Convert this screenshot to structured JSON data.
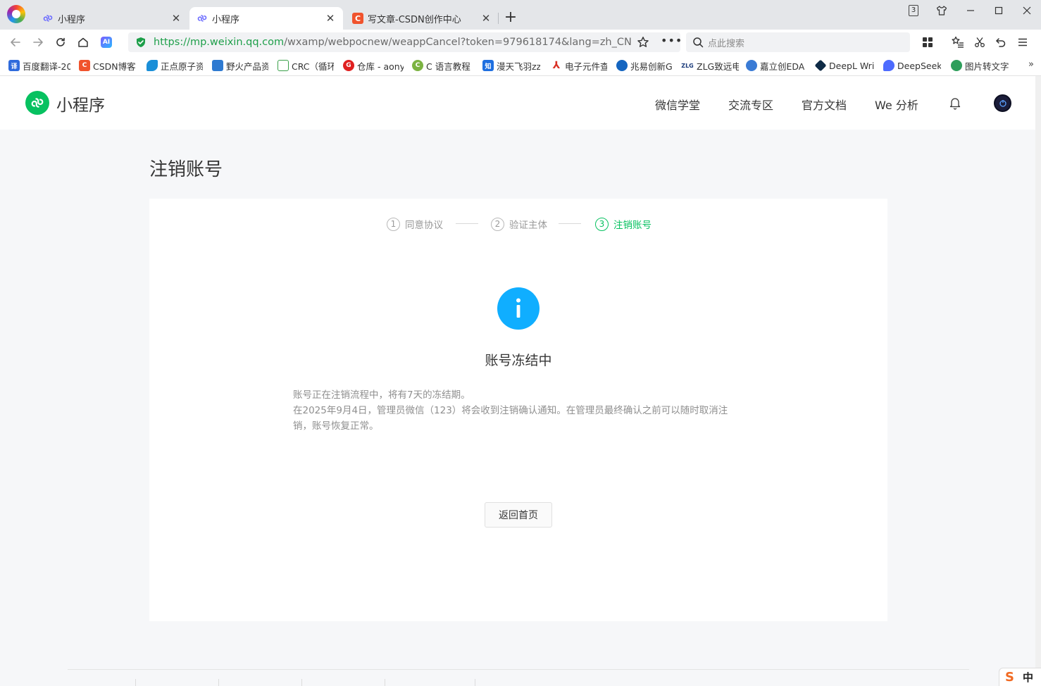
{
  "browser": {
    "tabs": [
      {
        "title": "小程序",
        "active": false
      },
      {
        "title": "小程序",
        "active": true
      },
      {
        "title": "写文章-CSDN创作中心",
        "active": false
      }
    ],
    "new_tab_label": "+",
    "tab_count": "3",
    "url": {
      "scheme_host": "https://mp.weixin.qq.com",
      "path": "/wxamp/webpocnew/weappCancel?token=979618174&lang=zh_CN"
    },
    "search_placeholder": "点此搜索",
    "ai_label": "AI",
    "bookmarks": [
      {
        "label": "百度翻译-20",
        "icon_color": "#2f6bdc",
        "glyph": "译"
      },
      {
        "label": "CSDN博客",
        "icon_color": "#f0532d",
        "glyph": "C"
      },
      {
        "label": "正点原子资",
        "icon_color": "#1a8fd8",
        "glyph": ""
      },
      {
        "label": "野火产品资",
        "icon_color": "#2e7ad1",
        "glyph": ""
      },
      {
        "label": "CRC（循环",
        "icon_color": "#3aa04a",
        "glyph": ""
      },
      {
        "label": "仓库 - aony",
        "icon_color": "#e02020",
        "glyph": "G"
      },
      {
        "label": "C 语言教程",
        "icon_color": "#7cb342",
        "glyph": "C"
      },
      {
        "label": "漫天飞羽zz",
        "icon_color": "#1e6fe0",
        "glyph": "知"
      },
      {
        "label": "电子元件查",
        "icon_color": "#d93025",
        "glyph": ""
      },
      {
        "label": "兆易创新GI",
        "icon_color": "#1565c0",
        "glyph": ""
      },
      {
        "label": "ZLG致远电",
        "icon_color": "#1a3a7a",
        "glyph": "ZLG"
      },
      {
        "label": "嘉立创EDA",
        "icon_color": "#3a7bd5",
        "glyph": ""
      },
      {
        "label": "DeepL Writ",
        "icon_color": "#0f2b46",
        "glyph": ""
      },
      {
        "label": "DeepSeek",
        "icon_color": "#4d6bfe",
        "glyph": ""
      },
      {
        "label": "图片转文字",
        "icon_color": "#2e9e5b",
        "glyph": ""
      }
    ],
    "bookmarks_more": "»"
  },
  "site": {
    "logo_text": "小程序",
    "nav": [
      "微信学堂",
      "交流专区",
      "官方文档",
      "We 分析"
    ],
    "brand_color": "#07c160"
  },
  "page": {
    "title": "注销账号",
    "steps": [
      {
        "num": "1",
        "label": "同意协议",
        "state": "done"
      },
      {
        "num": "2",
        "label": "验证主体",
        "state": "done"
      },
      {
        "num": "3",
        "label": "注销账号",
        "state": "current"
      }
    ],
    "info_glyph": "i",
    "status_title": "账号冻结中",
    "description": [
      "账号正在注销流程中，将有7天的冻结期。",
      "在2025年9月4日，管理员微信（123）将会收到注销确认通知。在管理员最终确认之前可以随时取消注销，账号恢复正常。"
    ],
    "back_button": "返回首页",
    "info_color": "#10aeff"
  },
  "ime": {
    "brand": "S",
    "mode": "中"
  }
}
